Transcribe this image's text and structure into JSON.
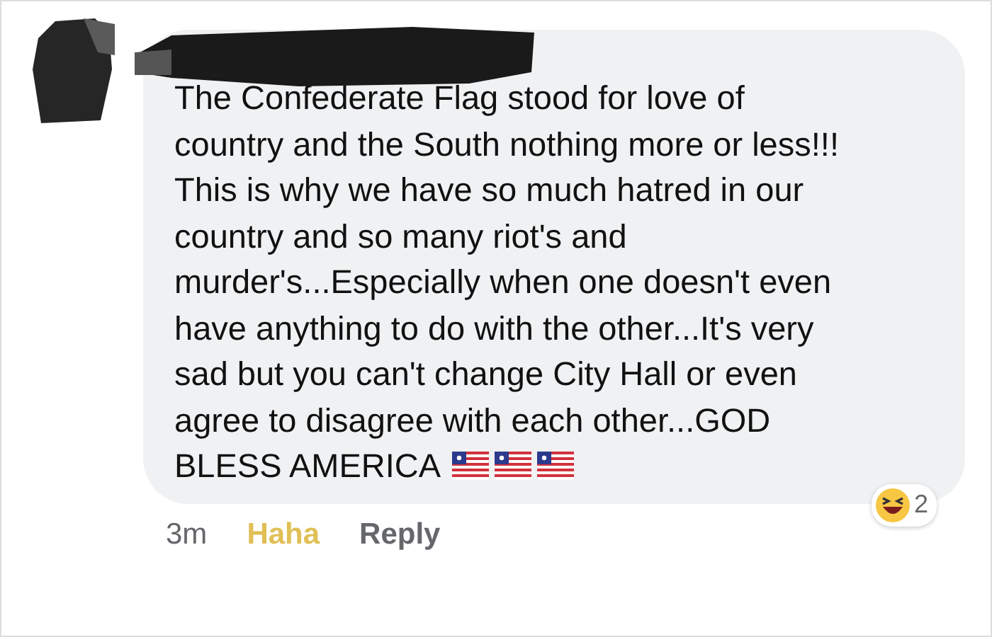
{
  "comment": {
    "text": "The Confederate Flag stood for love of country and the South nothing more or less!!! This is why we have so much hatred in our country and so many riot's and murder's...Especially when one doesn't even have anything to do with the other...It's very sad but you can't change City Hall or even agree to disagree with each other...GOD BLESS AMERICA",
    "time": "3m",
    "reaction": {
      "label": "Haha",
      "selected": true
    },
    "reply": "Reply",
    "reaction_count": "2"
  }
}
